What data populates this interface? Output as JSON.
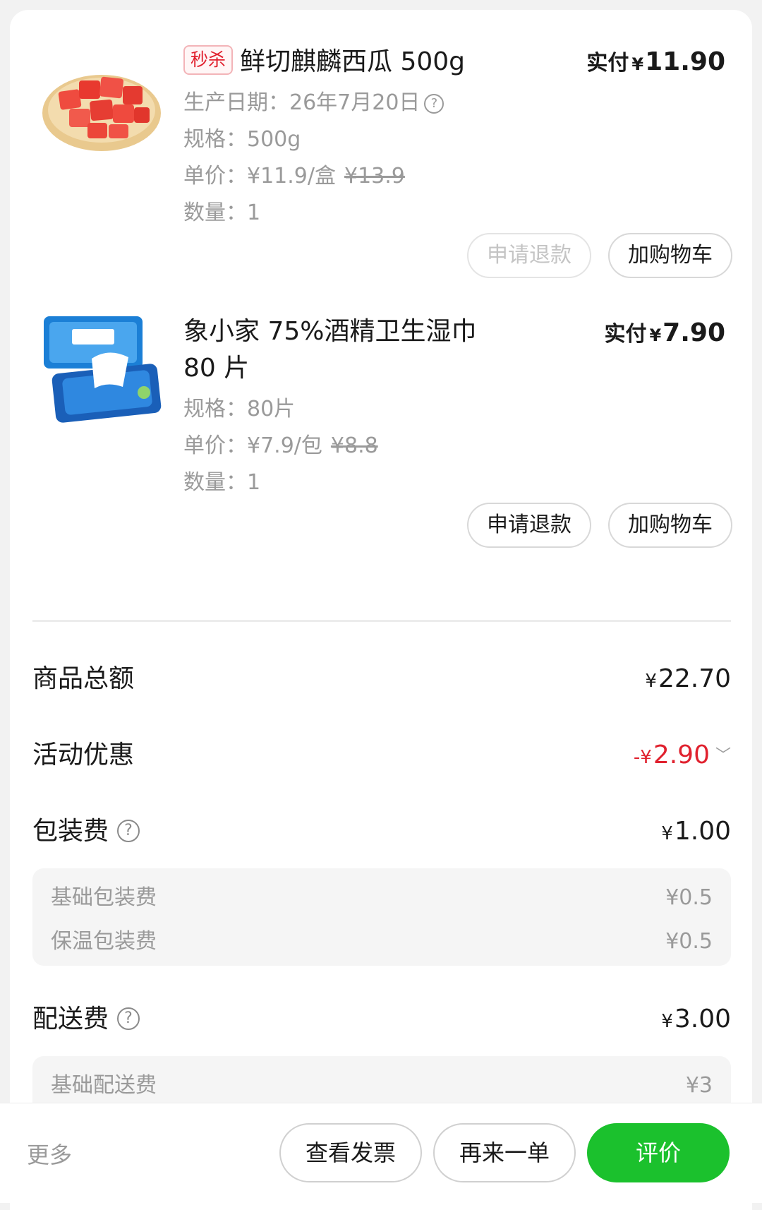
{
  "products": [
    {
      "image_icon": "watermelon-image",
      "tag": "秒杀",
      "title": "鲜切麒麟西瓜 500g",
      "paid_label": "实付",
      "currency": "¥",
      "paid_amount": "11.90",
      "production_date": "生产日期：26年7月20日",
      "spec": "规格：500g",
      "unit_price": "单价：¥11.9/盒",
      "original_price": "¥13.9",
      "quantity": "数量：1",
      "refund_label": "申请退款",
      "refund_enabled": false,
      "cart_label": "加购物车"
    },
    {
      "image_icon": "wet-wipes-image",
      "title_line1": "象小家 75%酒精卫生湿巾",
      "title_line2": "80 片",
      "paid_label": "实付",
      "currency": "¥",
      "paid_amount": "7.90",
      "spec": "规格：80片",
      "unit_price": "单价：¥7.9/包",
      "original_price": "¥8.8",
      "quantity": "数量：1",
      "refund_label": "申请退款",
      "refund_enabled": true,
      "cart_label": "加购物车"
    }
  ],
  "summary": {
    "goods_total_label": "商品总额",
    "goods_total_cur": "¥",
    "goods_total": "22.70",
    "discount_label": "活动优惠",
    "discount_prefix": "-¥",
    "discount": "2.90",
    "packaging_label": "包装费",
    "packaging_cur": "¥",
    "packaging": "1.00",
    "packaging_items": [
      {
        "label": "基础包装费",
        "value": "¥0.5"
      },
      {
        "label": "保温包装费",
        "value": "¥0.5"
      }
    ],
    "delivery_label": "配送费",
    "delivery_cur": "¥",
    "delivery": "3.00",
    "delivery_items": [
      {
        "label": "基础配送费",
        "value": "¥3"
      }
    ]
  },
  "bottom_bar": {
    "more": "更多",
    "invoice": "查看发票",
    "reorder": "再来一单",
    "review": "评价"
  },
  "colors": {
    "accent_green": "#1bc12d",
    "discount_red": "#e0212e"
  }
}
